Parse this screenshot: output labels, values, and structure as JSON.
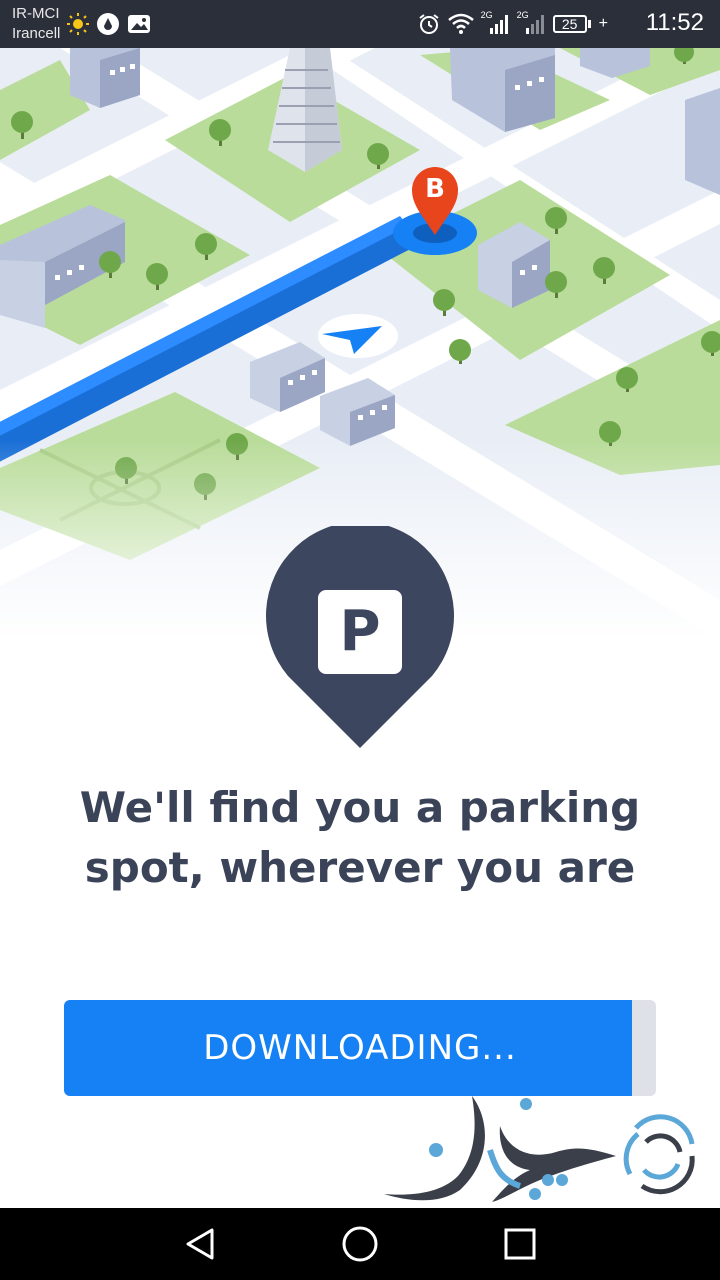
{
  "status_bar": {
    "carrier_line1": "IR-MCI",
    "carrier_line2": "Irancell",
    "left_icons": [
      "weather-sun-icon",
      "data-saver-icon",
      "photo-notification-icon"
    ],
    "right_icons": [
      "alarm-icon",
      "wifi-icon",
      "signal-2g-icon",
      "signal-2g-icon"
    ],
    "signal_label_1": "2G",
    "signal_label_2": "2G",
    "battery_level": "25",
    "charging_symbol": "+",
    "time": "11:52"
  },
  "illustration": {
    "destination_marker_letter": "B"
  },
  "main": {
    "headline_line1": "We'll find you a parking",
    "headline_line2": "spot, wherever you are",
    "parking_icon_letter": "P"
  },
  "download": {
    "label": "DOWNLOADING...",
    "progress": 0.96
  },
  "colors": {
    "status_bar": "#2b2f3a",
    "accent_blue": "#1581f4",
    "pin_dark": "#3c465e",
    "marker_red": "#e8451c",
    "grass_green": "#b9dc9a",
    "headline_text": "#3a4358"
  },
  "nav_bar": {
    "buttons": [
      "back-icon",
      "home-icon",
      "recent-apps-icon"
    ]
  }
}
